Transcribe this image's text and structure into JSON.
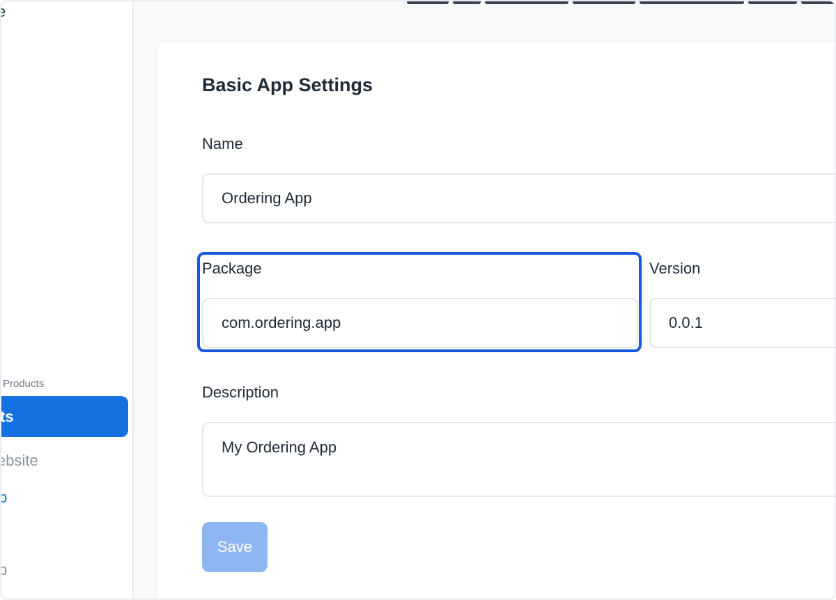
{
  "sidebar": {
    "top_glyph": "e",
    "section_label": "Products",
    "active_item_label": "ts",
    "items": [
      {
        "label": "ebsite"
      },
      {
        "label": "p"
      },
      {
        "label": "p"
      }
    ]
  },
  "form": {
    "title": "Basic App Settings",
    "name": {
      "label": "Name",
      "value": "Ordering App"
    },
    "package": {
      "label": "Package",
      "value": "com.ordering.app"
    },
    "version": {
      "label": "Version",
      "value": "0.0.1"
    },
    "description": {
      "label": "Description",
      "value": "My Ordering App"
    },
    "save_label": "Save"
  },
  "colors": {
    "accent": "#1570e2",
    "highlight_border": "#1858e0",
    "save_disabled": "#8db6f2"
  }
}
